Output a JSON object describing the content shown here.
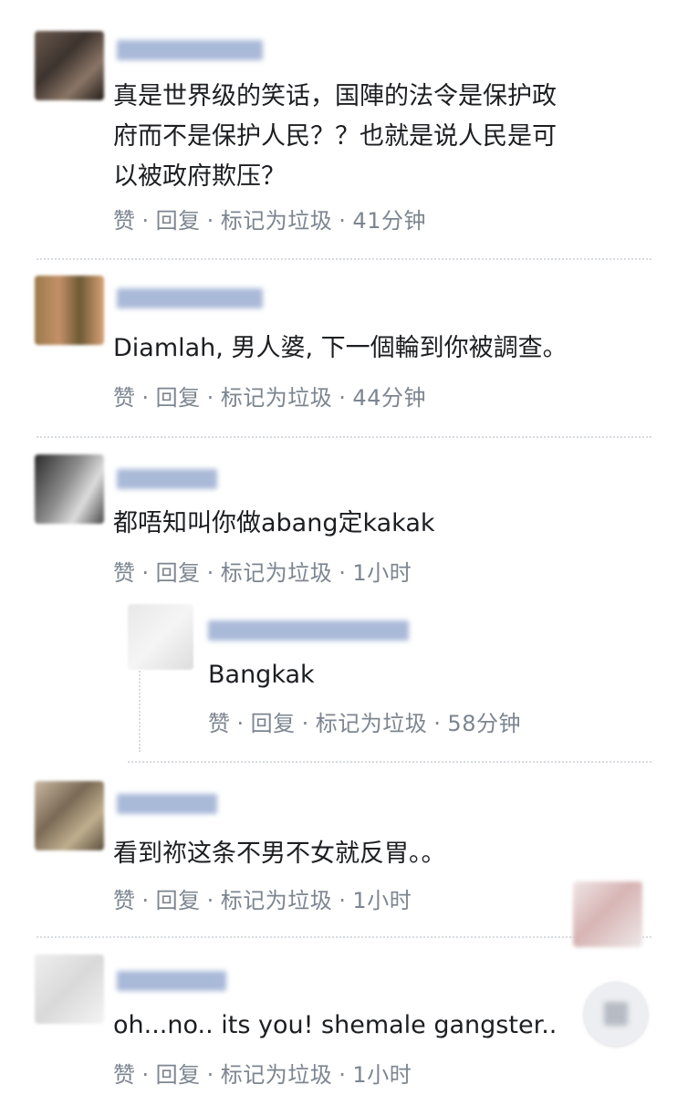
{
  "comments": [
    {
      "text": "真是世界级的笑话，国陣的法令是保护政\n府而不是保护人民？？也就是说人民是可\n以被政府欺压？",
      "like": "赞",
      "reply": "回复",
      "spam": "标记为垃圾",
      "time": "41分钟"
    },
    {
      "text": "Diamlah, 男人婆, 下一個輪到你被調查。",
      "like": "赞",
      "reply": "回复",
      "spam": "标记为垃圾",
      "time": "44分钟"
    },
    {
      "text": "都唔知叫你做abang定kakak",
      "like": "赞",
      "reply": "回复",
      "spam": "标记为垃圾",
      "time": "1小时"
    },
    {
      "text": "Bangkak",
      "like": "赞",
      "reply": "回复",
      "spam": "标记为垃圾",
      "time": "58分钟"
    },
    {
      "text": "看到祢这条不男不女就反胃。。",
      "like": "赞",
      "reply": "回复",
      "spam": "标记为垃圾",
      "time": "1小时"
    },
    {
      "text": "oh...no.. its you! shemale gangster..",
      "like": "赞",
      "reply": "回复",
      "spam": "标记为垃圾",
      "time": "1小时"
    }
  ],
  "colors": {
    "action_text": "#7d8590",
    "name_blur": "#9fb3d6",
    "divider": "#d7dbe0"
  }
}
